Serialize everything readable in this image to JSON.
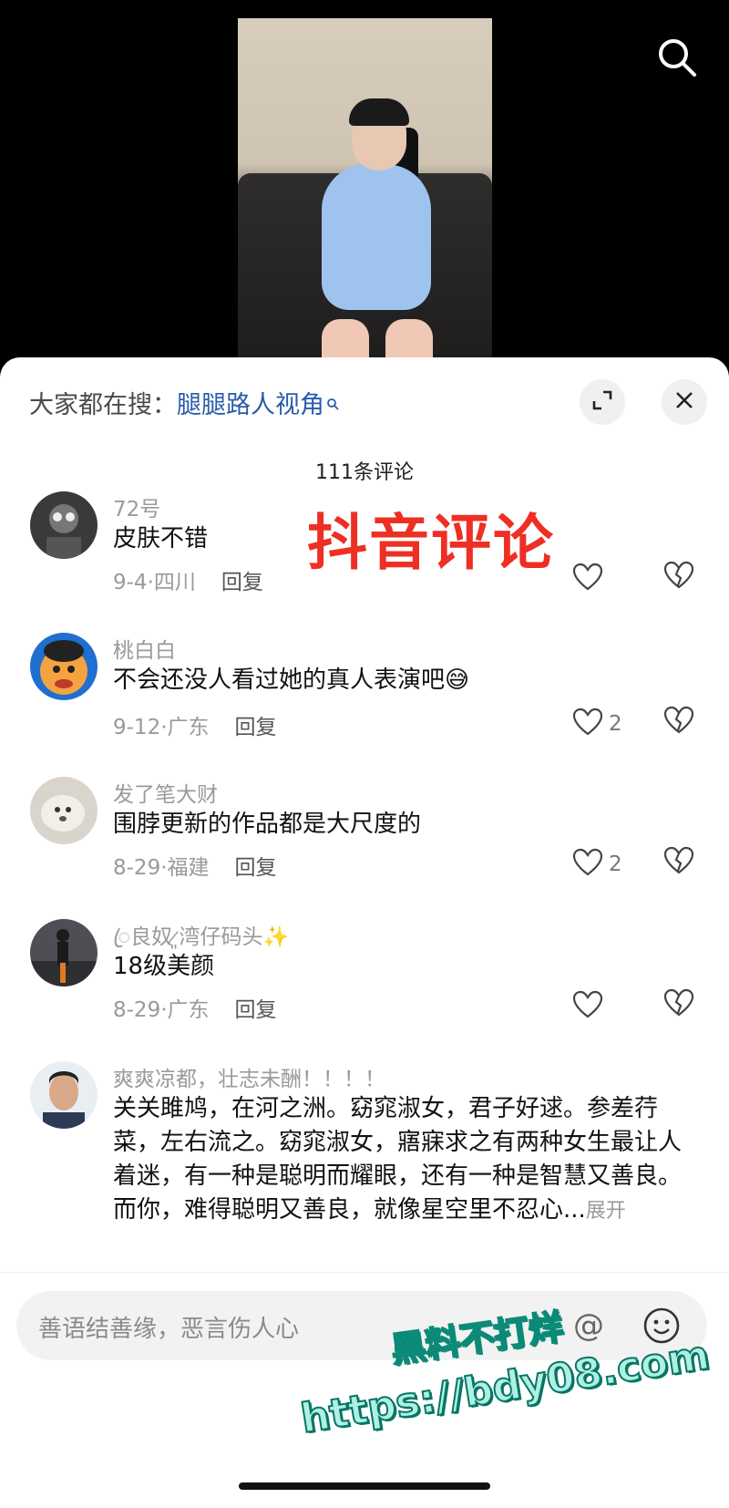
{
  "video": {
    "description_icon": "search-icon"
  },
  "header": {
    "hot_search_prefix": "大家都在搜：",
    "hot_search_link": "腿腿路人视角",
    "expand_icon": "expand-icon",
    "close_icon": "close-icon"
  },
  "comments_count": "111条评论",
  "watermark_text": "抖音评论",
  "comments": [
    {
      "user": "72号",
      "text": "皮肤不错",
      "date": "9-4·四川",
      "reply": "回复",
      "likes": ""
    },
    {
      "user": "桃白白",
      "text": "不会还没人看过她的真人表演吧😅",
      "date": "9-12·广东",
      "reply": "回复",
      "likes": "2"
    },
    {
      "user": "发了笔大财",
      "text": "围脖更新的作品都是大尺度的",
      "date": "8-29·福建",
      "reply": "回复",
      "likes": "2"
    },
    {
      "user": "ꦿ良奴  ̷͈湾仔码头✨",
      "text": "18级美颜",
      "date": "8-29·广东",
      "reply": "回复",
      "likes": ""
    },
    {
      "user": "爽爽凉都，壮志未酬！！！！",
      "text": "关关雎鸠，在河之洲。窈窕淑女，君子好逑。参差荇菜，左右流之。窈窕淑女，寤寐求之有两种女生最让人着迷，有一种是聪明而耀眼，还有一种是智慧又善良。而你，难得聪明又善良，就像星空里不忍心...",
      "expand": "展开"
    }
  ],
  "input": {
    "placeholder": "善语结善缘，恶言伤人心"
  },
  "overlay": {
    "promo_line1": "黑料不打烊",
    "promo_line2": "https://bdy08.com"
  },
  "colors": {
    "accent_red": "#ee2f24",
    "link_blue": "#2a5caa",
    "promo_teal": "#0c8a78"
  }
}
